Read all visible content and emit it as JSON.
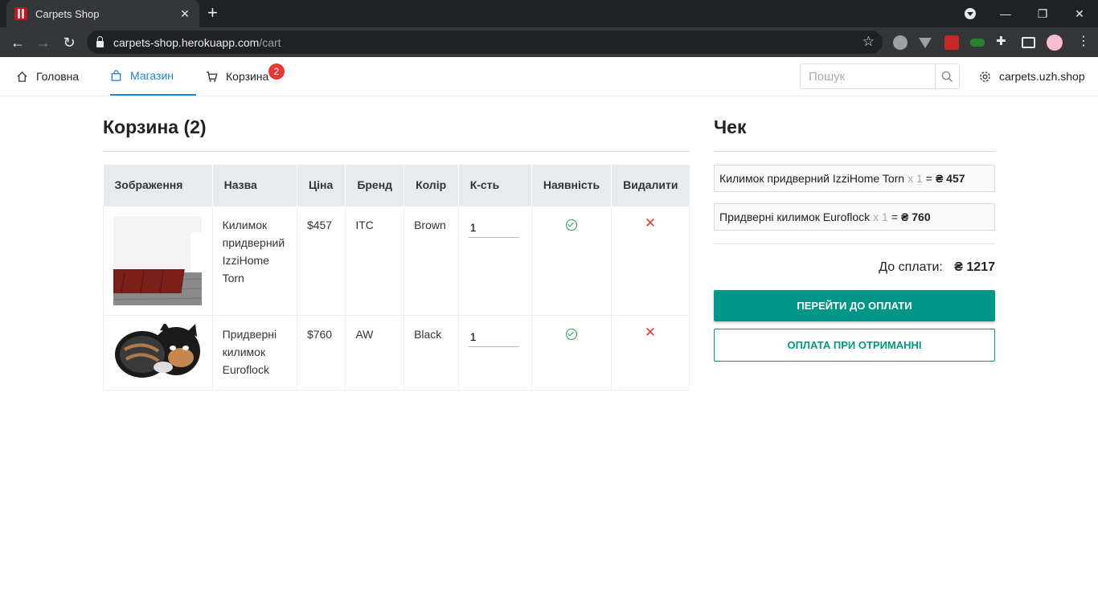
{
  "browser": {
    "tab_title": "Carpets Shop",
    "url_host": "carpets-shop.herokuapp.com",
    "url_path": "/cart"
  },
  "nav": {
    "home": "Головна",
    "shop": "Магазин",
    "cart": "Корзина",
    "cart_badge": "2",
    "search_placeholder": "Пошук",
    "site_link": "carpets.uzh.shop"
  },
  "cart": {
    "title": "Корзина (2)",
    "columns": [
      "Зображення",
      "Назва",
      "Ціна",
      "Бренд",
      "Колір",
      "К-сть",
      "Наявність",
      "Видалити"
    ],
    "items": [
      {
        "name": "Килимок придверний IzziHome Torn",
        "price": "$457",
        "brand": "ITC",
        "color": "Brown",
        "qty": "1",
        "available": true
      },
      {
        "name": "Придверні килимок Euroflock",
        "price": "$760",
        "brand": "AW",
        "color": "Black",
        "qty": "1",
        "available": true
      }
    ]
  },
  "receipt": {
    "title": "Чек",
    "lines": [
      {
        "name": "Килимок придверний IzziHome Torn",
        "mul": "x 1",
        "eq": "=",
        "sum": "₴ 457"
      },
      {
        "name": "Придверні килимок Euroflock",
        "mul": "x 1",
        "eq": "=",
        "sum": "₴ 760"
      }
    ],
    "total_label": "До сплати:",
    "total_value": "₴ 1217",
    "pay_button": "ПЕРЕЙТИ ДО ОПЛАТИ",
    "cod_button": "ОПЛАТА ПРИ ОТРИМАННІ"
  },
  "colors": {
    "accent": "#009688",
    "nav_active": "#2185d0",
    "badge": "#e53935",
    "available": "#21a35b",
    "delete": "#e53935"
  }
}
